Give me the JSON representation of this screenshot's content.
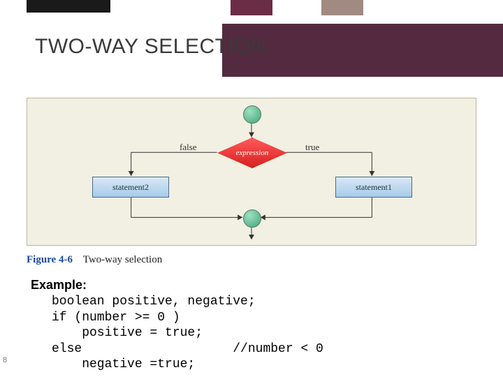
{
  "title": "TWO-WAY SELECTION",
  "diagram": {
    "expression": "expression",
    "false_label": "false",
    "true_label": "true",
    "statement1": "statement1",
    "statement2": "statement2"
  },
  "figure": {
    "num": "Figure 4-6",
    "caption": "Two-way selection"
  },
  "example": {
    "heading": "Example:",
    "line1": "boolean positive, negative;",
    "line2": "if (number >= 0 )",
    "line3": "    positive = true;",
    "line4": "else                    //number < 0",
    "line5": "    negative =true;"
  },
  "slide_number": "8"
}
